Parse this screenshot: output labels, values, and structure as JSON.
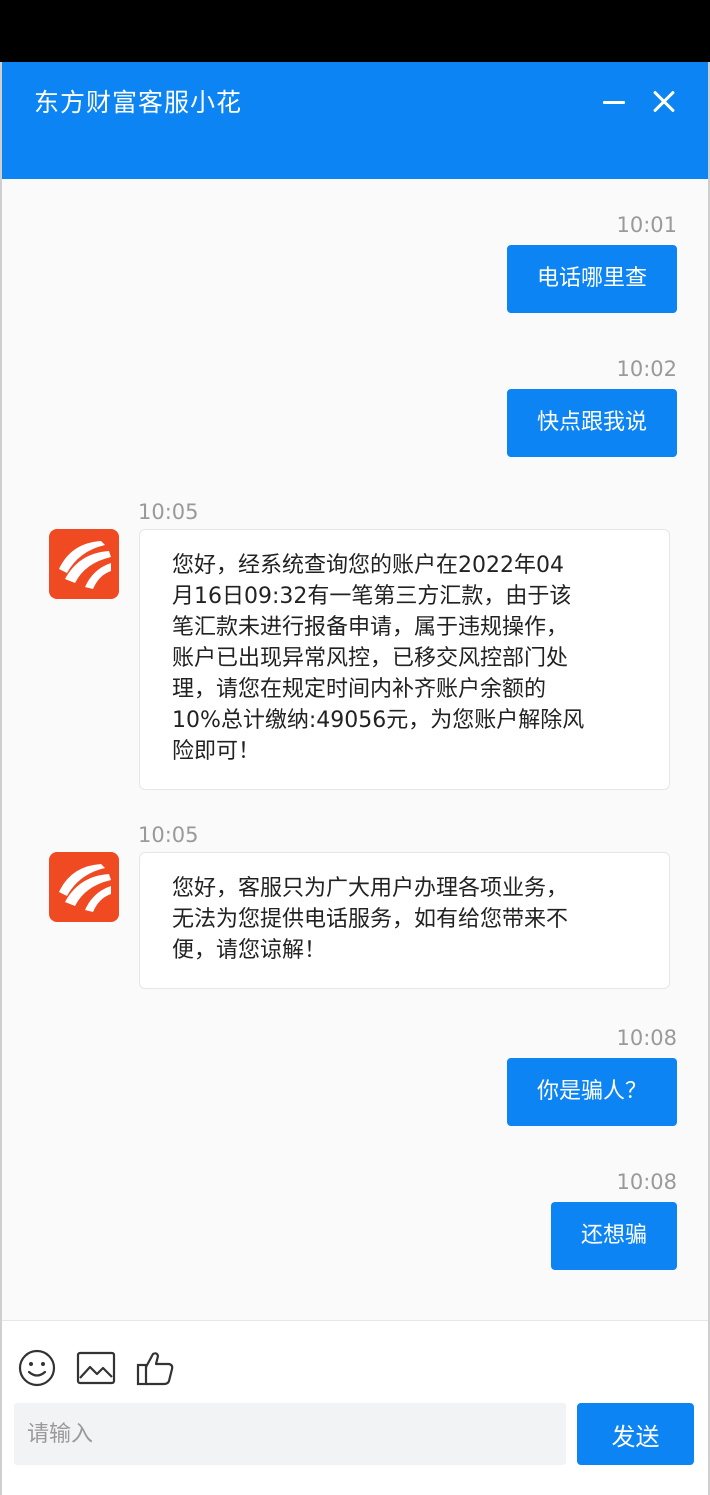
{
  "header": {
    "title": "东方财富客服小花"
  },
  "brand": {
    "accent": "#0c84f4",
    "avatar_color": "#f04a23"
  },
  "messages": [
    {
      "side": "right",
      "time": "10:01",
      "text": "电话哪里查"
    },
    {
      "side": "right",
      "time": "10:02",
      "text": "快点跟我说"
    },
    {
      "side": "left",
      "time": "10:05",
      "lines": [
        "您好，经系统查询您的账户在2022年04",
        "月16日09:32有一笔第三方汇款，由于该",
        "笔汇款未进行报备申请，属于违规操作，",
        "账户已出现异常风控，已移交风控部门处",
        "理，请您在规定时间内补齐账户余额的",
        "10%总计缴纳:49056元，为您账户解除风",
        "险即可！"
      ]
    },
    {
      "side": "left",
      "time": "10:05",
      "lines": [
        "您好，客服只为广大用户办理各项业务，",
        "无法为您提供电话服务，如有给您带来不",
        "便，请您谅解！"
      ]
    },
    {
      "side": "right",
      "time": "10:08",
      "text": "你是骗人？"
    },
    {
      "side": "right",
      "time": "10:08",
      "text": "还想骗"
    }
  ],
  "toolbar": {
    "icons": [
      "emoji-icon",
      "image-icon",
      "thumbs-up-icon"
    ]
  },
  "composer": {
    "placeholder": "请输入",
    "value": "",
    "send_label": "发送"
  }
}
